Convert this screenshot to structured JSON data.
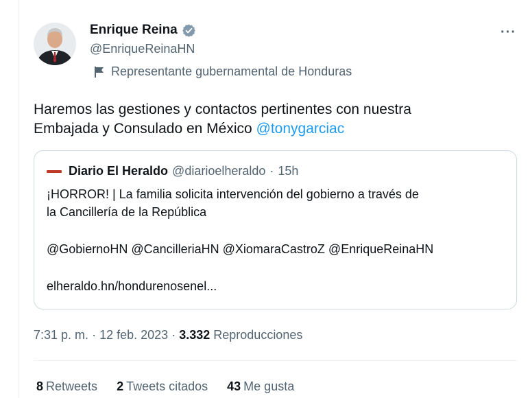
{
  "author": {
    "name": "Enrique Reina",
    "handle": "@EnriqueReinaHN",
    "label": "Representante gubernamental de Honduras",
    "avatar_icon": "person-avatar",
    "verified_icon": "verified-badge-icon",
    "verified_color": "#829aab"
  },
  "more_label": "···",
  "tweet": {
    "text_line1": "Haremos las gestiones y contactos pertinentes con nuestra",
    "text_line2": "Embajada y Consulado en México ",
    "mention": "@tonygarciac"
  },
  "quote": {
    "source_name": "Diario El Heraldo",
    "source_handle": "@diarioelheraldo",
    "separator": "·",
    "time": "15h",
    "body_line1": "¡HORROR! | La familia solicita intervención del gobierno a través de",
    "body_line2": "la Cancillería de la República",
    "mentions": "@GobiernoHN @CancilleriaHN @XiomaraCastroZ @EnriqueReinaHN",
    "link": "elheraldo.hn/hondurenosenel..."
  },
  "meta": {
    "time": "7:31 p. m.",
    "separator": "·",
    "date": "12 feb. 2023",
    "separator2": "·",
    "views": "3.332",
    "views_label": "Reproducciones"
  },
  "stats": {
    "retweets": "8",
    "retweets_label": "Retweets",
    "quotes": "2",
    "quotes_label": "Tweets citados",
    "likes": "43",
    "likes_label": "Me gusta"
  },
  "colors": {
    "accent": "#1d9bf0",
    "secondary_text": "#536471",
    "border": "#cfd9de"
  }
}
